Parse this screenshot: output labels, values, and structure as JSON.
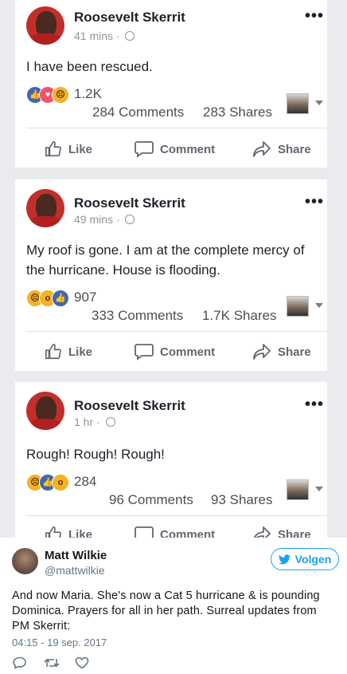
{
  "posts": [
    {
      "author": "Roosevelt Skerrit",
      "time": "41 mins",
      "text": "I have been rescued.",
      "reaction_icons": [
        "like",
        "love",
        "sad"
      ],
      "reaction_count": "1.2K",
      "comments": "284 Comments",
      "shares": "283 Shares"
    },
    {
      "author": "Roosevelt Skerrit",
      "time": "49 mins",
      "text": "My roof is gone. I am at the complete mercy of the hurricane. House is flooding.",
      "reaction_icons": [
        "sad",
        "wow",
        "like"
      ],
      "reaction_count": "907",
      "comments": "333 Comments",
      "shares": "1.7K Shares"
    },
    {
      "author": "Roosevelt Skerrit",
      "time": "1 hr",
      "text": "Rough! Rough! Rough!",
      "reaction_icons": [
        "sad",
        "like",
        "wow"
      ],
      "reaction_count": "284",
      "comments": "96 Comments",
      "shares": "93 Shares"
    }
  ],
  "actions": {
    "like": "Like",
    "comment": "Comment",
    "share": "Share"
  },
  "tweet": {
    "name": "Matt Wilkie",
    "handle": "@mattwilkie",
    "follow_label": "Volgen",
    "text": "And now Maria. She's now a Cat 5 hurricane & is pounding Dominica. Prayers for all in her path. Surreal updates from PM Skerrit:",
    "date": "04:15 - 19 sep. 2017"
  },
  "colors": {
    "fb_bg": "#e9ebee",
    "twitter_blue": "#1da1f2",
    "like_blue": "#4267b2"
  }
}
